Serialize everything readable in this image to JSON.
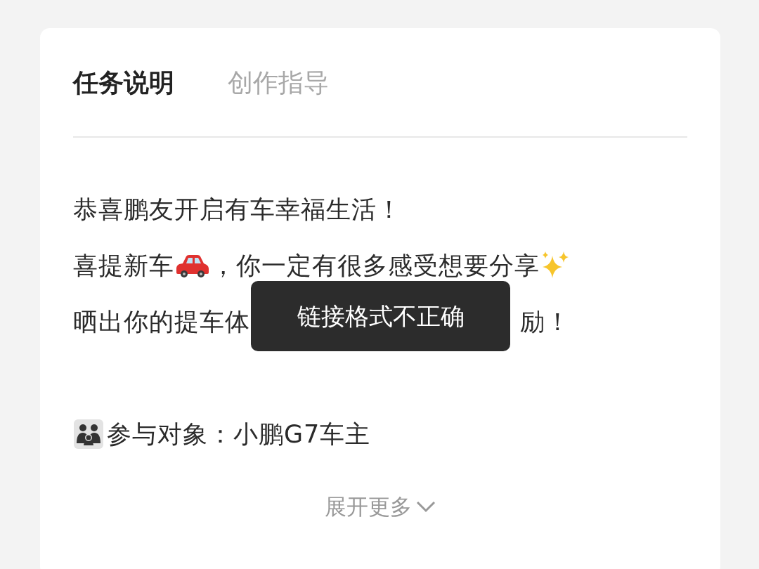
{
  "tabs": [
    {
      "label": "任务说明",
      "selected": true
    },
    {
      "label": "创作指导",
      "selected": false
    }
  ],
  "description": [
    {
      "parts": [
        {
          "kind": "text",
          "text": "恭喜鹏友开启有车幸福生活！"
        }
      ]
    },
    {
      "parts": [
        {
          "kind": "text",
          "text": "喜提新车"
        },
        {
          "kind": "emoji"
        },
        {
          "kind": "text",
          "text": "，你一定有很多感受想要分享"
        },
        {
          "kind": "emoji"
        }
      ]
    },
    {
      "parts": [
        {
          "kind": "text",
          "text": "晒出你的提车体"
        },
        {
          "kind": "covered"
        },
        {
          "kind": "text",
          "text": "励！"
        }
      ]
    },
    {
      "spaced": true,
      "parts": [
        {
          "kind": "emoji"
        },
        {
          "kind": "text",
          "text": "参与对象：小鹏G7车主"
        }
      ]
    }
  ],
  "expand_link": {
    "label": "展开更多"
  },
  "toast": {
    "message": "链接格式不正确"
  }
}
